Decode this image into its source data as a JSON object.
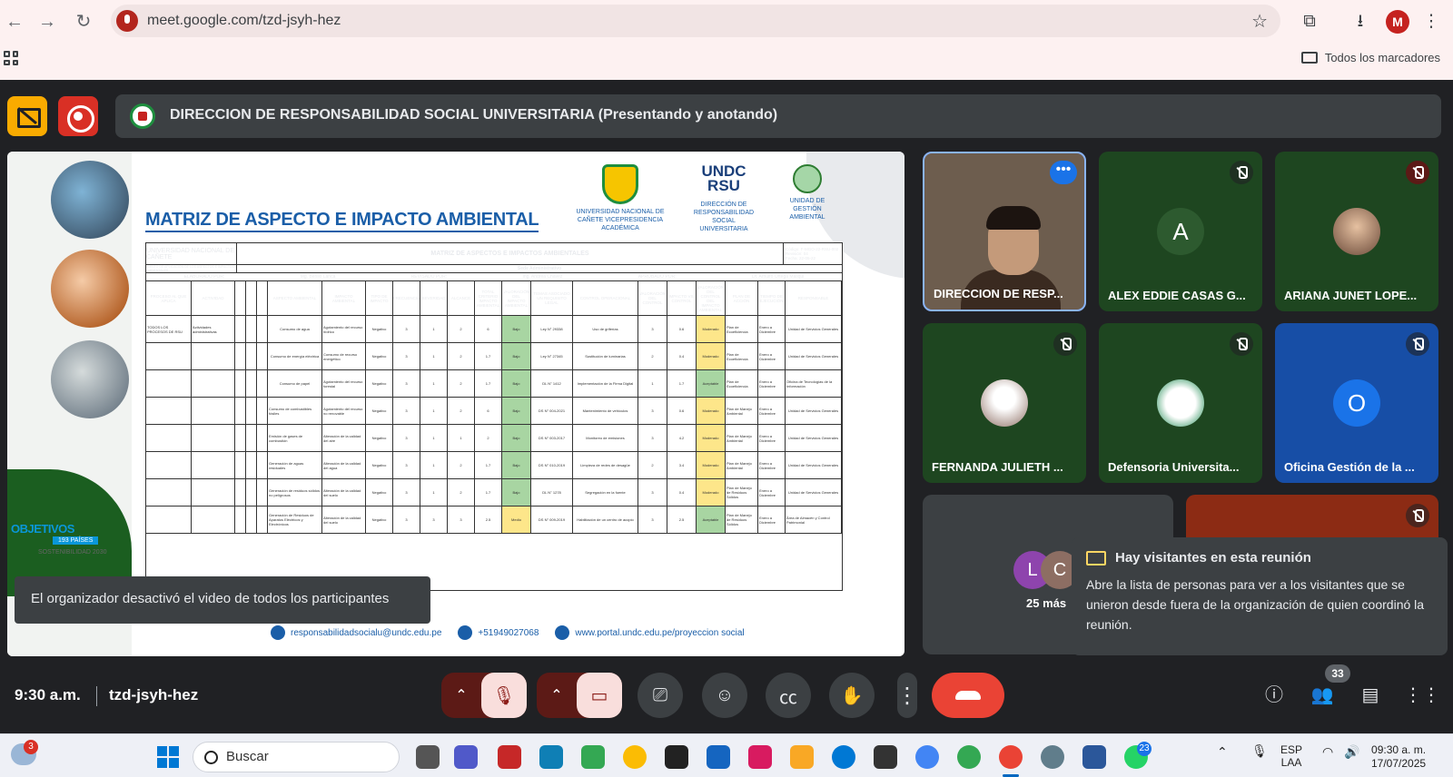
{
  "browser": {
    "url": "meet.google.com/tzd-jsyh-hez",
    "bookmarks_label": "Todos los marcadores",
    "profile_initial": "M"
  },
  "meet": {
    "presenter_banner": "DIRECCION DE RESPONSABILIDAD SOCIAL UNIVERSITARIA (Presentando y anotando)",
    "time": "9:30 a.m.",
    "meeting_code": "tzd-jsyh-hez",
    "participant_count": "33",
    "toast": "El organizador desactivó el video de todos los participantes",
    "more_count": "25 más",
    "notice": {
      "title": "Hay visitantes en esta reunión",
      "body": "Abre la lista de personas para ver a los visitantes que se unieron desde fuera de la organización de quien coordinó la reunión."
    },
    "tiles": [
      {
        "name": "DIRECCION DE RESP...",
        "initial": ""
      },
      {
        "name": "ALEX EDDIE CASAS G...",
        "initial": "A"
      },
      {
        "name": "ARIANA JUNET LOPE...",
        "initial": ""
      },
      {
        "name": "FERNANDA JULIETH ...",
        "initial": ""
      },
      {
        "name": "Defensoria Universita...",
        "initial": ""
      },
      {
        "name": "Oficina Gestión de la ...",
        "initial": "O"
      }
    ],
    "mini_avatars": [
      "L",
      "C"
    ]
  },
  "slide": {
    "heading": "MATRIZ DE ASPECTO E IMPACTO AMBIENTAL",
    "logo1": "UNIVERSIDAD NACIONAL DE CAÑETE VICEPRESIDENCIA ACADÉMICA",
    "logo2_mark": "UNDC RSU",
    "logo2": "DIRECCIÓN DE RESPONSABILIDAD SOCIAL UNIVERSITARIA",
    "logo3": "UNIDAD DE GESTIÓN AMBIENTAL",
    "sdg_title": "OBJETIVOS",
    "sdg_sub": "193 PAÍSES",
    "sdg_foot": "SOSTENIBILIDAD 2030",
    "doc_title": "MATRIZ DE ASPECTOS E IMPACTOS AMBIENTALES",
    "doc_org": "UNIVERSIDAD NACIONAL DE CAÑETE",
    "doc_code": "Código: F-MGO-22-RSU-002",
    "doc_rev": "Revisión: 04",
    "doc_date": "Fecha: 22-05-22",
    "sede": "Sede Administrativo",
    "scope_label": "ÁMBITO DE APLICACIÓN DE LOS ASPECTOS E IMPACTOS AMBIENTALES",
    "elab_label": "ELABORADO POR:",
    "elab_name": "Mg. Berilio Lanca",
    "rev_label": "REVISADO POR:",
    "rev_name": "Ing. Andrea Chávez",
    "apr_label": "APROBADO POR:",
    "apr_name": "Dr. Arnulfo Ortega Mallqui",
    "columns": [
      "PROCESO AL QUE APLICA",
      "ACTIVIDAD",
      "",
      "",
      "",
      "ASPECTO AMBIENTAL",
      "IMPACTO AMBIENTAL",
      "TIPO DE IMPACTO",
      "FRECUENCIA",
      "SEVERIDAD",
      "ALCANCE",
      "TOTAL CRITERIO IMPACTO AMBIENTAL",
      "VALORACIÓN DEL IMPACTO AMBIENTAL",
      "TEMAS ASOCIADO UN REQUISITO LEGAL",
      "CONTROL OPERACIONAL",
      "VALORACIÓN DEL CONTROL",
      "IMPACTO VS. CONTROL",
      "VALORACIÓN DEL CONTROL DEL IMPACTO AMBIENTAL",
      "PLAN DE ACCIÓN",
      "TIEMPO DE EJECUCIÓN",
      "RESPONSABLE"
    ],
    "rows": [
      [
        "TODOS LOS PROCESOS DE RSU",
        "Actividades administrativas",
        "",
        "",
        "",
        "Consumo de agua",
        "Agotamiento del recurso hídrico",
        "Negativo",
        "3",
        "1",
        "2",
        "6",
        "Bajo",
        "Ley N° 29338",
        "Uso de griferías",
        "3",
        "0.6",
        "Moderado",
        "Plan de Ecoeficiencia",
        "Enero a Diciembre",
        "Unidad de Servicios Generales"
      ],
      [
        "",
        "",
        "",
        "",
        "",
        "Consumo de energía eléctrica",
        "Consumo de recurso energético",
        "Negativo",
        "3",
        "1",
        "2",
        "1.7",
        "Bajo",
        "Ley N° 27345",
        "Sustitución de luminarias",
        "2",
        "0.4",
        "Moderado",
        "Plan de Ecoeficiencia",
        "Enero a Diciembre",
        "Unidad de Servicios Generales"
      ],
      [
        "",
        "",
        "",
        "",
        "",
        "Consumo de papel",
        "Agotamiento del recurso forestal",
        "Negativo",
        "3",
        "1",
        "2",
        "1.7",
        "Bajo",
        "DL N° 1412",
        "Implementación de la Firma Digital",
        "1",
        "1.7",
        "Aceptable",
        "Plan de Ecoeficiencia",
        "Enero a Diciembre",
        "Oficina de Tecnologías de la Información"
      ],
      [
        "",
        "",
        "",
        "",
        "",
        "Consumo de combustibles fósiles",
        "Agotamiento del recurso no renovable",
        "Negativo",
        "3",
        "1",
        "2",
        "6",
        "Bajo",
        "DS N° 004-2021",
        "Mantenimiento de vehículos",
        "3",
        "0.6",
        "Moderado",
        "Plan de Manejo Ambiental",
        "Enero a Diciembre",
        "Unidad de Servicios Generales"
      ],
      [
        "",
        "",
        "",
        "",
        "",
        "Emisión de gases de combustión",
        "Alteración de la calidad del aire",
        "Negativo",
        "3",
        "1",
        "1",
        "2",
        "Bajo",
        "DS N° 003-2017",
        "Monitoreo de emisiones",
        "3",
        "4.2",
        "Moderado",
        "Plan de Manejo Ambiental",
        "Enero a Diciembre",
        "Unidad de Servicios Generales"
      ],
      [
        "",
        "",
        "",
        "",
        "",
        "Generación de aguas residuales",
        "Alteración de la calidad del agua",
        "Negativo",
        "3",
        "1",
        "2",
        "1.7",
        "Bajo",
        "DS N° 010-2019",
        "Limpieza de redes de desagüe",
        "2",
        "3.4",
        "Moderado",
        "Plan de Manejo Ambiental",
        "Enero a Diciembre",
        "Unidad de Servicios Generales"
      ],
      [
        "",
        "",
        "",
        "",
        "",
        "Generación de residuos sólidos no peligrosos",
        "Alteración de la calidad del suelo",
        "Negativo",
        "3",
        "1",
        "2",
        "1.7",
        "Bajo",
        "DL N° 1278",
        "Segregación en la fuente",
        "3",
        "0.4",
        "Moderado",
        "Plan de Manejo de Residuos Sólidos",
        "Enero a Diciembre",
        "Unidad de Servicios Generales"
      ],
      [
        "",
        "",
        "",
        "",
        "",
        "Generación de Residuos de Aparatos Eléctricos y Electrónicos",
        "Alteración de la calidad del suelo",
        "Negativo",
        "3",
        "3",
        "3",
        "2.5",
        "Medio",
        "DS N° 009-2019",
        "Habilitación de un centro de acopio",
        "3",
        "2.5",
        "Aceptable",
        "Plan de Manejo de Residuos Sólidos",
        "Enero a Diciembre",
        "Área de Almacén y Control Patrimonial"
      ]
    ],
    "footer_email": "responsabilidadsocialu@undc.edu.pe",
    "footer_phone": "+51949027068",
    "footer_web": "www.portal.undc.edu.pe/proyeccion social"
  },
  "taskbar": {
    "search_placeholder": "Buscar",
    "weather_badge": "3",
    "whatsapp_badge": "23",
    "lang": "ESP",
    "lang2": "LAA",
    "time": "09:30 a. m.",
    "date": "17/07/2025"
  },
  "colors": {
    "meet_bg": "#202124",
    "tile_bg": "#3c4043",
    "end_call": "#ea4335",
    "slide_blue": "#1a5ea8"
  }
}
